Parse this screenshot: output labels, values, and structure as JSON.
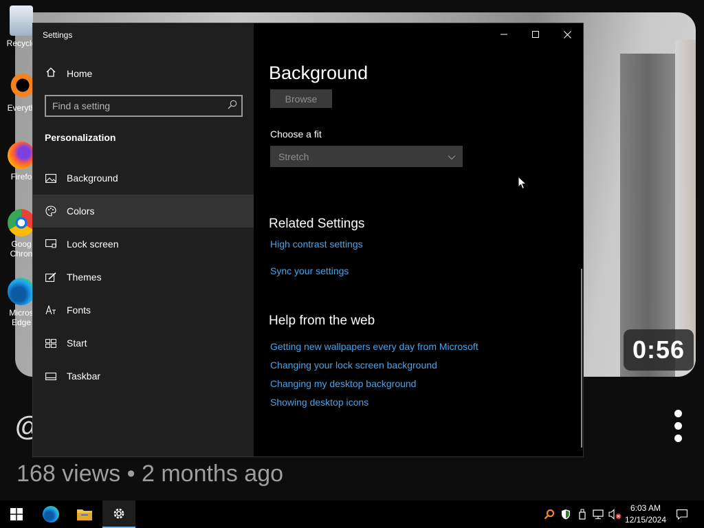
{
  "desktop": {
    "icons": [
      {
        "label": "Recycle"
      },
      {
        "label": "Everyth"
      },
      {
        "label": "Firefo"
      },
      {
        "label": "Goog Chron"
      },
      {
        "label": "Micros Edge"
      }
    ]
  },
  "video": {
    "timestamp": "0:56",
    "views_line": "168 views • 2 months ago",
    "channel_prefix": "@"
  },
  "window": {
    "title": "Settings",
    "controls": {
      "minimize": "—",
      "maximize": "☐",
      "close": "✕"
    }
  },
  "sidebar": {
    "home_label": "Home",
    "search_placeholder": "Find a setting",
    "section_title": "Personalization",
    "items": [
      {
        "label": "Background",
        "icon": "image-icon"
      },
      {
        "label": "Colors",
        "icon": "palette-icon",
        "active": true
      },
      {
        "label": "Lock screen",
        "icon": "monitor-lock-icon"
      },
      {
        "label": "Themes",
        "icon": "brush-icon"
      },
      {
        "label": "Fonts",
        "icon": "font-icon"
      },
      {
        "label": "Start",
        "icon": "start-grid-icon"
      },
      {
        "label": "Taskbar",
        "icon": "taskbar-icon"
      }
    ]
  },
  "content": {
    "title": "Background",
    "browse_label": "Browse",
    "fit_label": "Choose a fit",
    "fit_value": "Stretch",
    "related_heading": "Related Settings",
    "related_links": [
      "High contrast settings",
      "Sync your settings"
    ],
    "help_heading": "Help from the web",
    "help_links": [
      "Getting new wallpapers every day from Microsoft",
      "Changing your lock screen background",
      "Changing my desktop background",
      "Showing desktop icons"
    ]
  },
  "taskbar": {
    "time": "6:03 AM",
    "date": "12/15/2024"
  },
  "colors": {
    "accent_link": "#4aa3e8",
    "sidebar_bg": "#1f1f1f",
    "active_item_bg": "#333333"
  }
}
